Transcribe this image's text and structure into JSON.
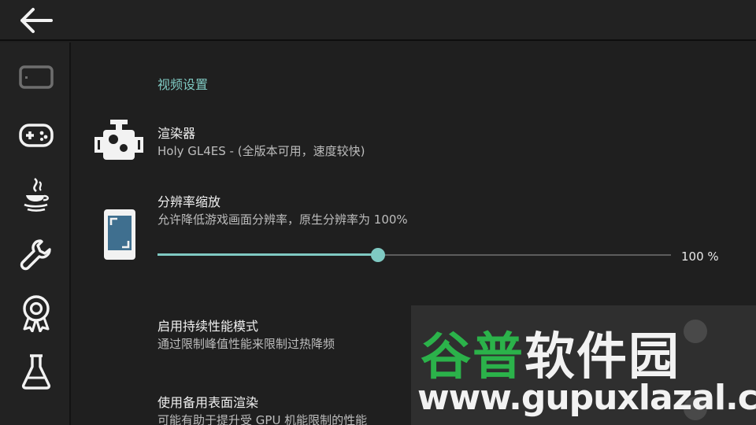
{
  "colors": {
    "accent": "#7fc9c2",
    "background": "#1f1f1f",
    "bar": "#222222",
    "watermark_green": "#2bb24a"
  },
  "topbar": {
    "back_icon": "arrow-left-icon"
  },
  "sidebar": {
    "items": [
      {
        "name": "video-settings",
        "icon": "tablet-landscape-icon",
        "selected": true
      },
      {
        "name": "controls",
        "icon": "gamepad-icon"
      },
      {
        "name": "java",
        "icon": "java-cup-icon"
      },
      {
        "name": "misc",
        "icon": "wrench-icon"
      },
      {
        "name": "experimental",
        "icon": "badge-icon"
      },
      {
        "name": "lab",
        "icon": "flask-icon"
      }
    ]
  },
  "main": {
    "section_title": "视频设置",
    "renderer": {
      "title": "渲染器",
      "summary": "Holy GL4ES - (全版本可用，速度较快)",
      "icon": "engine-icon"
    },
    "resolution": {
      "title": "分辨率缩放",
      "summary": "允许降低游戏画面分辨率，原生分辨率为 100%",
      "icon": "phone-screen-icon",
      "slider_fraction": 0.43,
      "value_text": "100 %"
    },
    "sustained": {
      "title": "启用持续性能模式",
      "summary": "通过限制峰值性能来限制过热降频"
    },
    "alt_surface": {
      "title": "使用备用表面渲染",
      "summary": "可能有助于提升受 GPU 机能限制的性能"
    }
  },
  "watermark": {
    "cn_part1": "谷普",
    "cn_part2": "软件园",
    "url": "www.gupuxlazal.com"
  }
}
